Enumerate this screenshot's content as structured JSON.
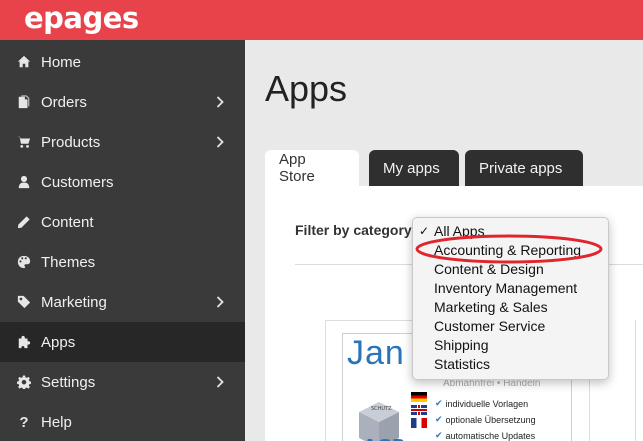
{
  "brand": {
    "logo_text": "epages",
    "bar_color": "#e8434b"
  },
  "sidebar": {
    "items": [
      {
        "label": "Home",
        "icon": "home-icon",
        "chevron": false,
        "active": false
      },
      {
        "label": "Orders",
        "icon": "orders-icon",
        "chevron": true,
        "active": false
      },
      {
        "label": "Products",
        "icon": "cart-icon",
        "chevron": true,
        "active": false
      },
      {
        "label": "Customers",
        "icon": "user-icon",
        "chevron": false,
        "active": false
      },
      {
        "label": "Content",
        "icon": "pencil-icon",
        "chevron": false,
        "active": false
      },
      {
        "label": "Themes",
        "icon": "palette-icon",
        "chevron": false,
        "active": false
      },
      {
        "label": "Marketing",
        "icon": "tag-icon",
        "chevron": true,
        "active": false
      },
      {
        "label": "Apps",
        "icon": "puzzle-icon",
        "chevron": false,
        "active": true
      },
      {
        "label": "Settings",
        "icon": "gear-icon",
        "chevron": true,
        "active": false
      },
      {
        "label": "Help",
        "icon": "question-icon",
        "chevron": false,
        "active": false
      }
    ]
  },
  "main": {
    "title": "Apps",
    "tabs": [
      {
        "label": "App Store",
        "active": true
      },
      {
        "label": "My apps",
        "active": false
      },
      {
        "label": "Private apps",
        "active": false
      }
    ],
    "filter": {
      "label": "Filter by category",
      "selected": "All Apps",
      "options": [
        "All Apps",
        "Accounting & Reporting",
        "Content & Design",
        "Inventory Management",
        "Marketing & Sales",
        "Customer Service",
        "Shipping",
        "Statistics"
      ],
      "highlighted": "Accounting & Reporting",
      "highlight_color": "#e0262c"
    },
    "app_card": {
      "logo_text": "Jan",
      "subtitle": "Abmahnfrei • Handeln",
      "features": [
        "individuelle Vorlagen",
        "optionale Übersetzung",
        "automatische Updates"
      ],
      "box_label": "SCHUTZ"
    }
  }
}
